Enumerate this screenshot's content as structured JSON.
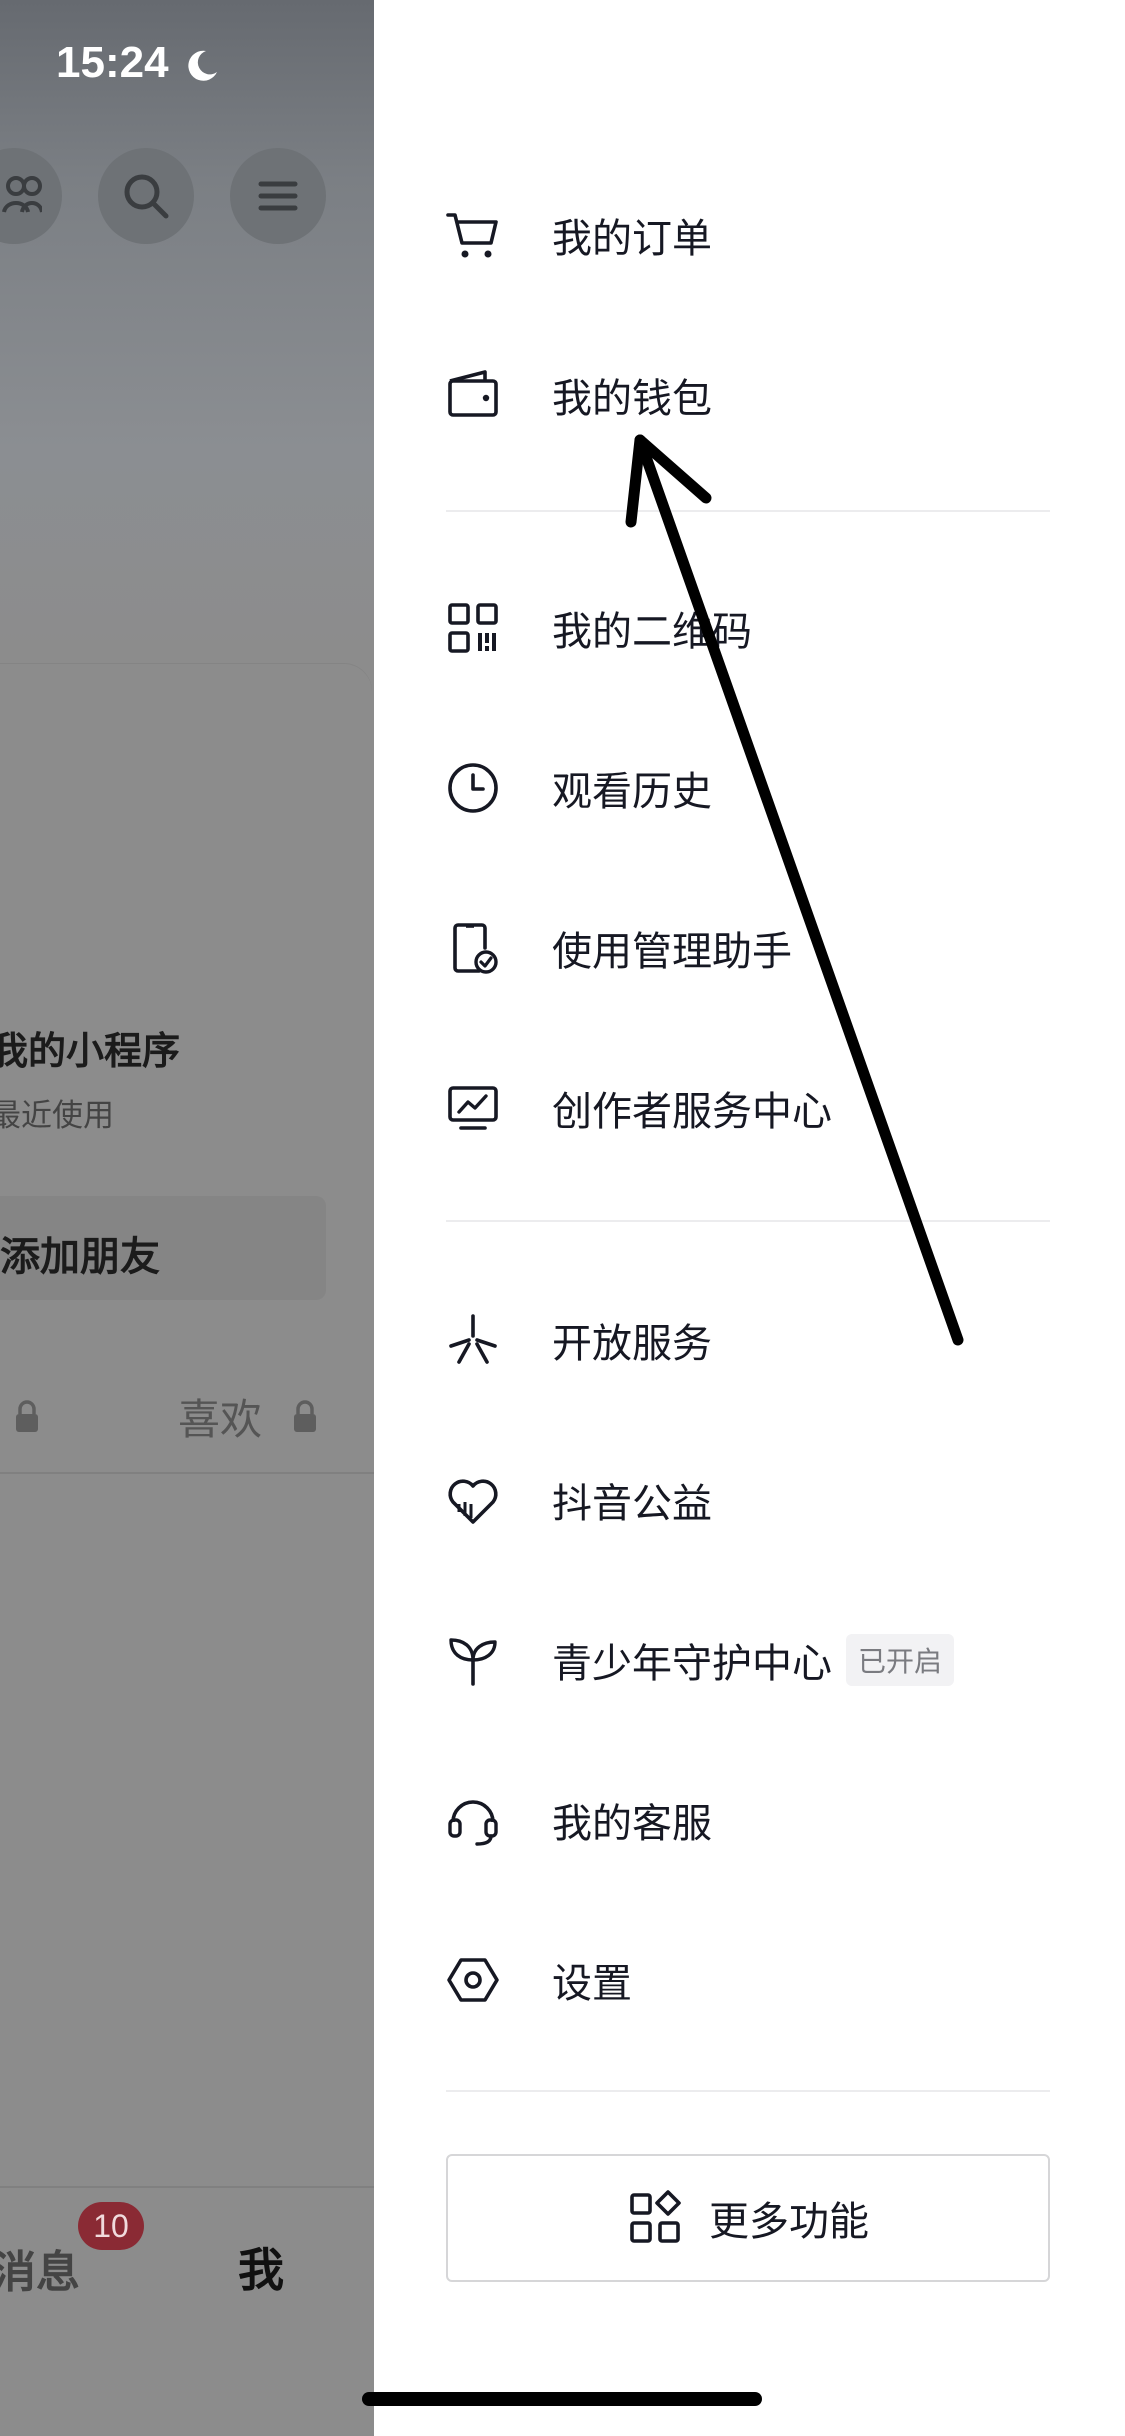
{
  "status_bar": {
    "time": "15:24"
  },
  "background_page": {
    "mini_programs_title": "我的小程序",
    "mini_programs_subtitle": "最近使用",
    "add_friend_label": "添加朋友",
    "likes_tab_label": "喜欢",
    "nav_messages_label": "消息",
    "nav_messages_badge": "10",
    "nav_me_label": "我"
  },
  "drawer": {
    "group1": [
      {
        "label": "我的订单",
        "icon": "cart-icon"
      },
      {
        "label": "我的钱包",
        "icon": "wallet-icon"
      }
    ],
    "group2": [
      {
        "label": "我的二维码",
        "icon": "qr-code-icon"
      },
      {
        "label": "观看历史",
        "icon": "clock-icon"
      },
      {
        "label": "使用管理助手",
        "icon": "phone-check-icon"
      },
      {
        "label": "创作者服务中心",
        "icon": "monitor-chart-icon"
      }
    ],
    "group3": [
      {
        "label": "开放服务",
        "icon": "asterisk-icon"
      },
      {
        "label": "抖音公益",
        "icon": "heart-icon"
      },
      {
        "label": "青少年守护中心",
        "icon": "sprout-icon",
        "tag": "已开启"
      },
      {
        "label": "我的客服",
        "icon": "headset-icon"
      },
      {
        "label": "设置",
        "icon": "settings-hexagon-icon"
      }
    ],
    "more_button_label": "更多功能"
  },
  "colors": {
    "badge": "#fe2c55",
    "text": "#161823",
    "overlay": "#8c8c8c"
  }
}
